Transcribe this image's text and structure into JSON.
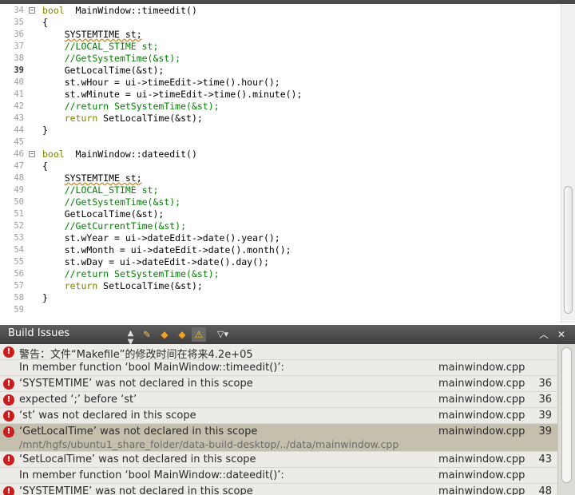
{
  "editor": {
    "current_line": 39,
    "lines": [
      {
        "n": "34",
        "fold": "−",
        "parts": [
          [
            "kw",
            "bool"
          ],
          [
            "",
            "  MainWindow::timeedit()"
          ]
        ]
      },
      {
        "n": "35",
        "parts": [
          [
            "",
            "{"
          ]
        ]
      },
      {
        "n": "36",
        "parts": [
          [
            "",
            "    "
          ],
          [
            "err",
            "SYSTEMTIME st;"
          ]
        ]
      },
      {
        "n": "37",
        "parts": [
          [
            "",
            "    "
          ],
          [
            "cm",
            "//LOCAL_STIME st;"
          ]
        ]
      },
      {
        "n": "38",
        "parts": [
          [
            "",
            "    "
          ],
          [
            "cm",
            "//GetSystemTime(&st);"
          ]
        ]
      },
      {
        "n": "39",
        "parts": [
          [
            "",
            "    GetLocalTime(&st);"
          ]
        ]
      },
      {
        "n": "40",
        "parts": [
          [
            "",
            "    st.wHour = ui->timeEdit->time().hour();"
          ]
        ]
      },
      {
        "n": "41",
        "parts": [
          [
            "",
            "    st.wMinute = ui->timeEdit->time().minute();"
          ]
        ]
      },
      {
        "n": "42",
        "parts": [
          [
            "",
            "    "
          ],
          [
            "cm",
            "//return SetSystemTime(&st);"
          ]
        ]
      },
      {
        "n": "43",
        "parts": [
          [
            "",
            "    "
          ],
          [
            "kw",
            "return"
          ],
          [
            "",
            " SetLocalTime(&st);"
          ]
        ]
      },
      {
        "n": "44",
        "parts": [
          [
            "",
            "}"
          ]
        ]
      },
      {
        "n": "45",
        "parts": []
      },
      {
        "n": "46",
        "fold": "−",
        "parts": [
          [
            "kw",
            "bool"
          ],
          [
            "",
            "  MainWindow::dateedit()"
          ]
        ]
      },
      {
        "n": "47",
        "parts": [
          [
            "",
            "{"
          ]
        ]
      },
      {
        "n": "48",
        "parts": [
          [
            "",
            "    "
          ],
          [
            "err",
            "SYSTEMTIME st;"
          ]
        ]
      },
      {
        "n": "49",
        "parts": [
          [
            "",
            "    "
          ],
          [
            "cm",
            "//LOCAL_STIME st;"
          ]
        ]
      },
      {
        "n": "50",
        "parts": [
          [
            "",
            "    "
          ],
          [
            "cm",
            "//GetSystemTime(&st);"
          ]
        ]
      },
      {
        "n": "51",
        "parts": [
          [
            "",
            "    GetLocalTime(&st);"
          ]
        ]
      },
      {
        "n": "52",
        "parts": [
          [
            "",
            "    "
          ],
          [
            "cm",
            "//GetCurrentTime(&st);"
          ]
        ]
      },
      {
        "n": "53",
        "parts": [
          [
            "",
            "    st.wYear = ui->dateEdit->date().year();"
          ]
        ]
      },
      {
        "n": "54",
        "parts": [
          [
            "",
            "    st.wMonth = ui->dateEdit->date().month();"
          ]
        ]
      },
      {
        "n": "55",
        "parts": [
          [
            "",
            "    st.wDay = ui->dateEdit->date().day();"
          ]
        ]
      },
      {
        "n": "56",
        "parts": [
          [
            "",
            "    "
          ],
          [
            "cm",
            "//return SetSystemTime(&st);"
          ]
        ]
      },
      {
        "n": "57",
        "parts": [
          [
            "",
            "    "
          ],
          [
            "kw",
            "return"
          ],
          [
            "",
            " SetLocalTime(&st);"
          ]
        ]
      },
      {
        "n": "58",
        "parts": [
          [
            "",
            "}"
          ]
        ]
      },
      {
        "n": "59",
        "parts": []
      }
    ]
  },
  "build_issues": {
    "title": "Build Issues",
    "selector_glyph": "▲▼",
    "toolbar": {
      "clean_icon": "broom-icon",
      "prev_icon": "arrow-left-icon",
      "next_icon": "arrow-right-icon",
      "warning_icon": "warning-icon",
      "filter_icon": "filter-icon",
      "maximize_icon": "chevron-up-icon",
      "close_icon": "close-icon"
    },
    "glyphs": {
      "clean": "✎",
      "prev": "◆",
      "next": "◆",
      "warning": "⚠",
      "filter": "▽▾",
      "maximize": "︿",
      "close": "✕"
    },
    "colors": {
      "error": "#c81e1e",
      "selected_row": "#c5bfad",
      "header": "#4a4a4a"
    },
    "rows": [
      {
        "icon": "error",
        "message": "警告：文件“Makefile”的修改时间在将来4.2e+05",
        "file": "",
        "line": ""
      },
      {
        "icon": "none",
        "message": "In member function ‘bool MainWindow::timeedit()’:",
        "file": "mainwindow.cpp",
        "line": ""
      },
      {
        "icon": "error",
        "message": "‘SYSTEMTIME’ was not declared in this scope",
        "file": "mainwindow.cpp",
        "line": "36"
      },
      {
        "icon": "error",
        "message": "expected ‘;’ before ‘st’",
        "file": "mainwindow.cpp",
        "line": "36"
      },
      {
        "icon": "error",
        "message": "‘st’ was not declared in this scope",
        "file": "mainwindow.cpp",
        "line": "39"
      },
      {
        "icon": "error",
        "message": "‘GetLocalTime’ was not declared in this scope",
        "path": "/mnt/hgfs/ubuntu1_share_folder/data-build-desktop/../data/mainwindow.cpp",
        "file": "mainwindow.cpp",
        "line": "39",
        "selected": true
      },
      {
        "icon": "error",
        "message": "‘SetLocalTime’ was not declared in this scope",
        "file": "mainwindow.cpp",
        "line": "43"
      },
      {
        "icon": "none",
        "message": "In member function ‘bool MainWindow::dateedit()’:",
        "file": "mainwindow.cpp",
        "line": ""
      },
      {
        "icon": "error",
        "message": "‘SYSTEMTIME’ was not declared in this scope",
        "file": "mainwindow.cpp",
        "line": "48"
      }
    ]
  }
}
